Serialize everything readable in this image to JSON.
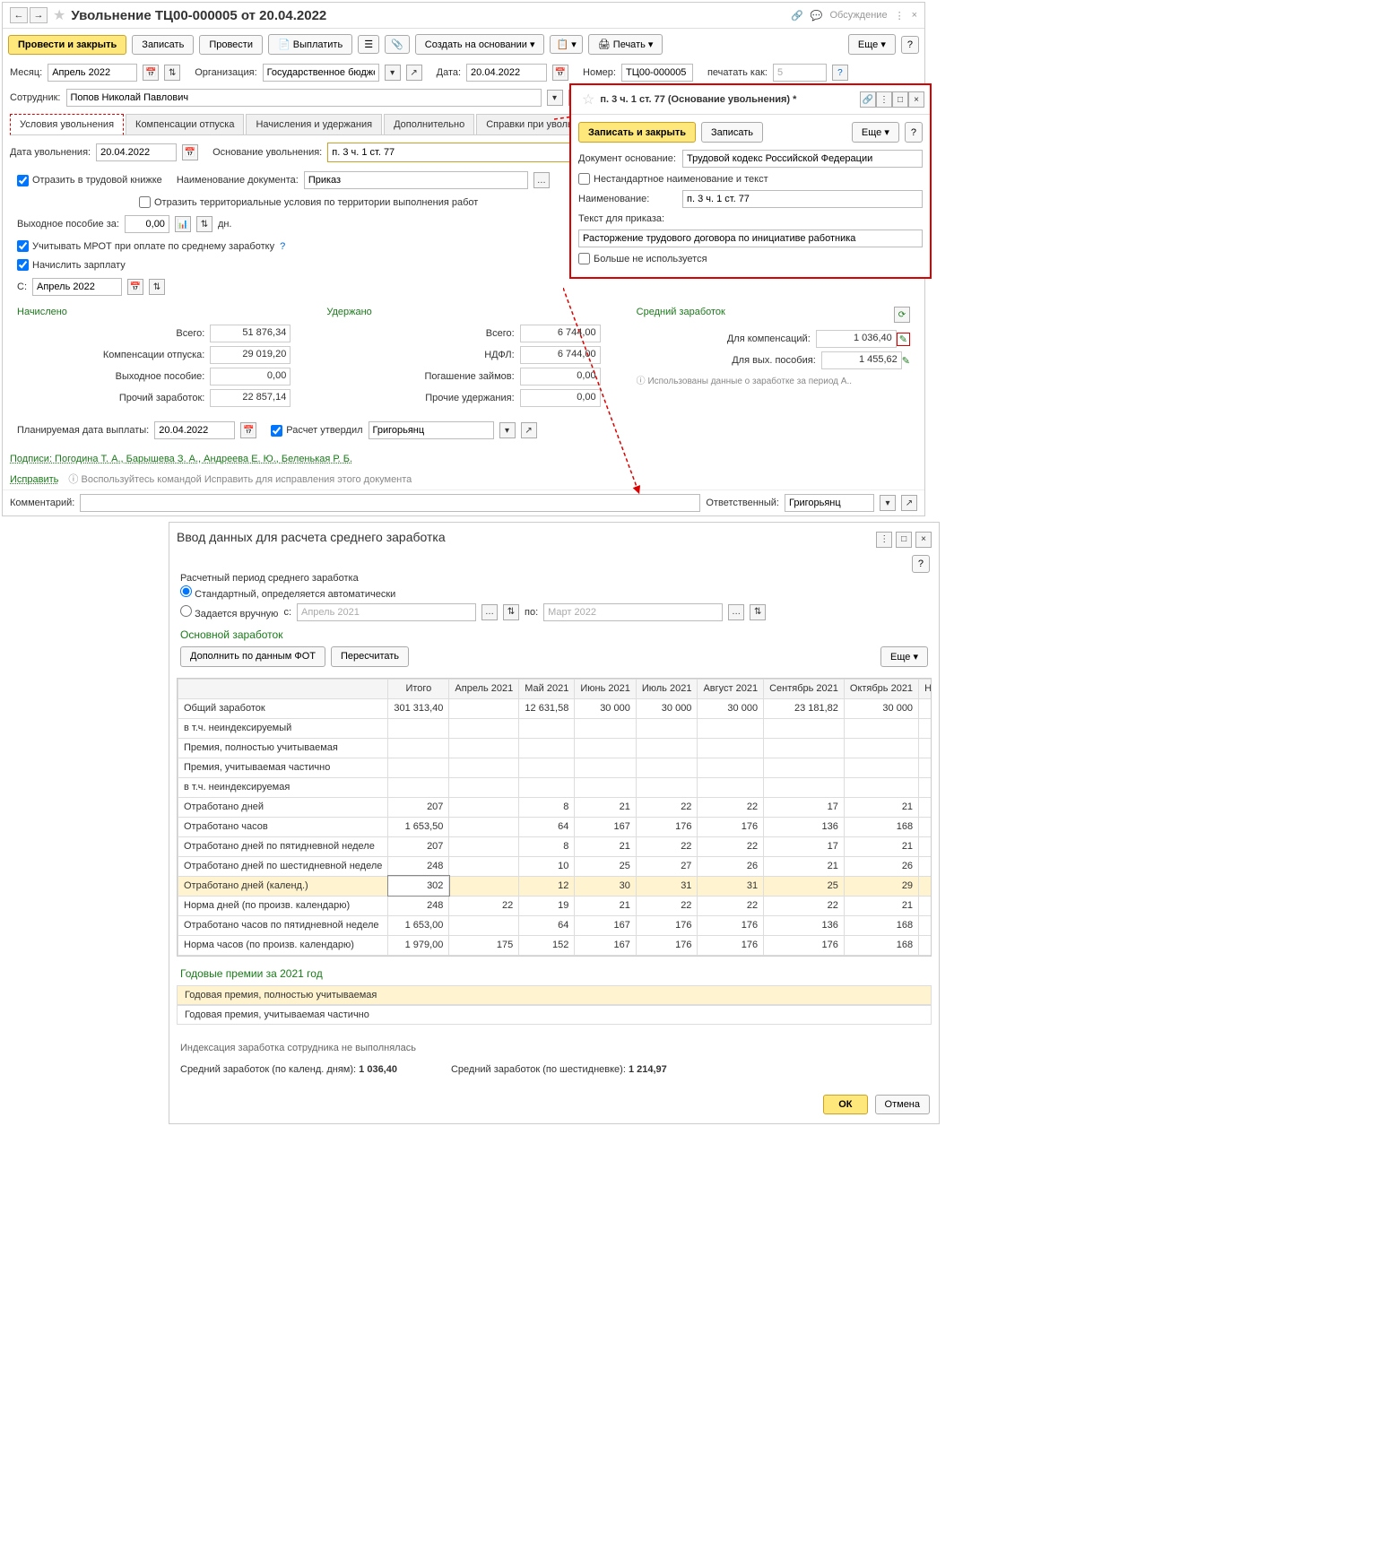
{
  "title": "Увольнение ТЦ00-000005 от 20.04.2022",
  "discuss": "Обсуждение",
  "toolbar": {
    "post_close": "Провести и закрыть",
    "save": "Записать",
    "post": "Провести",
    "pay": "Выплатить",
    "create_based": "Создать на основании",
    "print": "Печать",
    "more": "Еще"
  },
  "hdr": {
    "month_lbl": "Месяц:",
    "month": "Апрель 2022",
    "org_lbl": "Организация:",
    "org": "Государственное бюджетное",
    "date_lbl": "Дата:",
    "date": "20.04.2022",
    "num_lbl": "Номер:",
    "num": "ТЦ00-000005",
    "print_as_lbl": "печатать как:",
    "print_as": "5",
    "emp_lbl": "Сотрудник:",
    "emp": "Попов Николай Павлович"
  },
  "tabs": [
    "Условия увольнения",
    "Компенсации отпуска",
    "Начисления и удержания",
    "Дополнительно",
    "Справки при увольнении"
  ],
  "cond": {
    "date_lbl": "Дата увольнения:",
    "date": "20.04.2022",
    "basis_lbl": "Основание увольнения:",
    "basis": "п. 3 ч. 1 ст. 77",
    "reflect_lbl": "Отразить в трудовой книжке",
    "docname_lbl": "Наименование документа:",
    "docname": "Приказ",
    "terr_lbl": "Отразить территориальные условия по территории выполнения работ",
    "sev_lbl": "Выходное пособие за:",
    "sev_val": "0,00",
    "sev_unit": "дн.",
    "mrot_lbl": "Учитывать МРОТ при оплате по среднему заработку",
    "salary_lbl": "Начислить зарплату",
    "from_lbl": "С:",
    "from": "Апрель 2022"
  },
  "popup": {
    "title": "п. 3 ч. 1 ст. 77 (Основание увольнения) *",
    "save_close": "Записать и закрыть",
    "save": "Записать",
    "more": "Еще",
    "doc_lbl": "Документ основание:",
    "doc": "Трудовой кодекс Российской Федерации",
    "custom_lbl": "Нестандартное наименование и текст",
    "name_lbl": "Наименование:",
    "name": "п. 3 ч. 1 ст. 77",
    "order_text_lbl": "Текст для приказа:",
    "order_text": "Расторжение трудового договора по инициативе работника",
    "unused_lbl": "Больше не используется"
  },
  "totals": {
    "accrued": "Начислено",
    "withheld": "Удержано",
    "avg": "Средний заработок",
    "total_lbl": "Всего:",
    "total1": "51 876,34",
    "total2": "6 744,00",
    "comp_lbl": "Компенсации отпуска:",
    "comp": "29 019,20",
    "ndfl_lbl": "НДФЛ:",
    "ndfl": "6 744,00",
    "sev_lbl": "Выходное пособие:",
    "sev": "0,00",
    "loan_lbl": "Погашение займов:",
    "loan": "0,00",
    "other_lbl": "Прочий заработок:",
    "other": "22 857,14",
    "othd_lbl": "Прочие удержания:",
    "othd": "0,00",
    "avg_comp_lbl": "Для компенсаций:",
    "avg_comp": "1 036,40",
    "avg_sev_lbl": "Для вых. пособия:",
    "avg_sev": "1 455,62",
    "info": "Использованы данные о заработке за период А..",
    "plan_date_lbl": "Планируемая дата выплаты:",
    "plan_date": "20.04.2022",
    "appr_lbl": "Расчет утвердил",
    "appr": "Григорьянц"
  },
  "sign_lbl": "Подписи: Погодина Т. А., Барышева З. А., Андреева Е. Ю., Беленькая Р. Б.",
  "fix": "Исправить",
  "fix_info": "Воспользуйтесь командой Исправить для исправления этого документа",
  "comment_lbl": "Комментарий:",
  "resp_lbl": "Ответственный:",
  "resp": "Григорьянц",
  "p2": {
    "title": "Ввод данных для расчета среднего заработка",
    "period_lbl": "Расчетный период среднего заработка",
    "std": "Стандартный, определяется автоматически",
    "manual": "Задается вручную",
    "from_lbl": "с:",
    "to_lbl": "по:",
    "from": "Апрель 2021",
    "to": "Март 2022",
    "section1": "Основной заработок",
    "fill_btn": "Дополнить по данным ФОТ",
    "recalc_btn": "Пересчитать",
    "more": "Еще",
    "section2": "Годовые премии за 2021 год",
    "bonus1": "Годовая премия, полностью учитываемая",
    "bonus2": "Годовая премия, учитываемая частично",
    "index_note": "Индексация заработка сотрудника не выполнялась",
    "avg1_lbl": "Средний заработок (по календ. дням):",
    "avg1": "1 036,40",
    "avg2_lbl": "Средний заработок (по шестидневке):",
    "avg2": "1 214,97",
    "ok": "ОК",
    "cancel": "Отмена",
    "cols": [
      "Итого",
      "Апрель 2021",
      "Май 2021",
      "Июнь 2021",
      "Июль 2021",
      "Август 2021",
      "Сентябрь 2021",
      "Октябрь 2021",
      "Ноябрь"
    ],
    "rows": [
      {
        "label": "Общий заработок",
        "vals": [
          "301 313,40",
          "",
          "12 631,58",
          "30 000",
          "30 000",
          "30 000",
          "23 181,82",
          "30 000",
          ""
        ]
      },
      {
        "label": "в т.ч. неиндексируемый",
        "vals": [
          "",
          "",
          "",
          "",
          "",
          "",
          "",
          "",
          ""
        ]
      },
      {
        "label": "Премия, полностью учитываемая",
        "vals": [
          "",
          "",
          "",
          "",
          "",
          "",
          "",
          "",
          ""
        ]
      },
      {
        "label": "Премия, учитываемая частично",
        "vals": [
          "",
          "",
          "",
          "",
          "",
          "",
          "",
          "",
          ""
        ]
      },
      {
        "label": "в т.ч. неиндексируемая",
        "vals": [
          "",
          "",
          "",
          "",
          "",
          "",
          "",
          "",
          ""
        ]
      },
      {
        "label": "Отработано дней",
        "vals": [
          "207",
          "",
          "8",
          "21",
          "22",
          "22",
          "17",
          "21",
          ""
        ]
      },
      {
        "label": "Отработано часов",
        "vals": [
          "1 653,50",
          "",
          "64",
          "167",
          "176",
          "176",
          "136",
          "168",
          ""
        ]
      },
      {
        "label": "Отработано дней по пятидневной неделе",
        "vals": [
          "207",
          "",
          "8",
          "21",
          "22",
          "22",
          "17",
          "21",
          ""
        ]
      },
      {
        "label": "Отработано дней по шестидневной неделе",
        "vals": [
          "248",
          "",
          "10",
          "25",
          "27",
          "26",
          "21",
          "26",
          ""
        ]
      },
      {
        "label": "Отработано дней (календ.)",
        "vals": [
          "302",
          "",
          "12",
          "30",
          "31",
          "31",
          "25",
          "29",
          ""
        ],
        "hl": true
      },
      {
        "label": "Норма дней (по произв. календарю)",
        "vals": [
          "248",
          "22",
          "19",
          "21",
          "22",
          "22",
          "22",
          "21",
          ""
        ]
      },
      {
        "label": "Отработано часов по пятидневной неделе",
        "vals": [
          "1 653,00",
          "",
          "64",
          "167",
          "176",
          "176",
          "136",
          "168",
          ""
        ]
      },
      {
        "label": "Норма часов (по произв. календарю)",
        "vals": [
          "1 979,00",
          "175",
          "152",
          "167",
          "176",
          "176",
          "176",
          "168",
          ""
        ]
      }
    ]
  }
}
